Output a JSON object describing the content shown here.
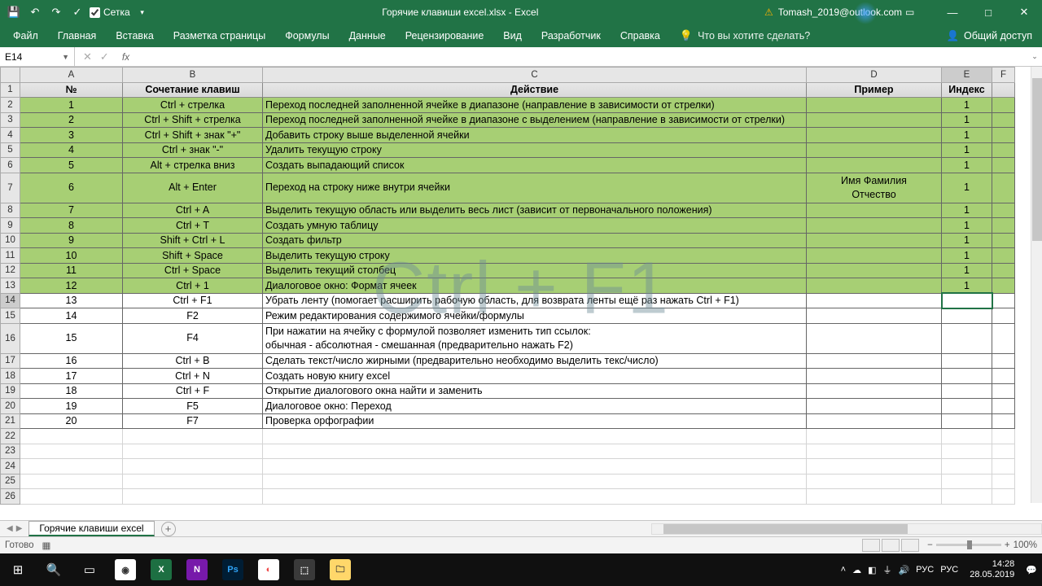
{
  "titlebar": {
    "grid_label": "Сетка",
    "doc_title": "Горячие клавиши excel.xlsx  -  Excel",
    "user": "Tomash_2019@outlook.com"
  },
  "ribbon": {
    "tabs": [
      "Файл",
      "Главная",
      "Вставка",
      "Разметка страницы",
      "Формулы",
      "Данные",
      "Рецензирование",
      "Вид",
      "Разработчик",
      "Справка"
    ],
    "tellme": "Что вы хотите сделать?",
    "share": "Общий доступ"
  },
  "formula": {
    "namebox": "E14",
    "fx": "fx",
    "value": ""
  },
  "columns": [
    "A",
    "B",
    "C",
    "D",
    "E",
    "F"
  ],
  "headers": {
    "num": "№",
    "combo": "Сочетание клавиш",
    "action": "Действие",
    "example": "Пример",
    "index": "Индекс"
  },
  "watermark": "Ctrl + F1",
  "chart_data": {
    "type": "table",
    "columns": [
      "№",
      "Сочетание клавиш",
      "Действие",
      "Пример",
      "Индекс"
    ],
    "rows": [
      {
        "n": 1,
        "combo": "Ctrl + стрелка",
        "action": "Переход последней заполненной ячейке в диапазоне (направление в зависимости от стрелки)",
        "ex": "",
        "idx": 1,
        "g": true
      },
      {
        "n": 2,
        "combo": "Ctrl + Shift + стрелка",
        "action": "Переход последней заполненной ячейке в диапазоне с выделением (направление в зависимости от стрелки)",
        "ex": "",
        "idx": 1,
        "g": true
      },
      {
        "n": 3,
        "combo": "Ctrl + Shift + знак \"+\"",
        "action": "Добавить строку выше выделенной ячейки",
        "ex": "",
        "idx": 1,
        "g": true
      },
      {
        "n": 4,
        "combo": "Ctrl + знак \"-\"",
        "action": "Удалить текущую строку",
        "ex": "",
        "idx": 1,
        "g": true
      },
      {
        "n": 5,
        "combo": "Alt + стрелка вниз",
        "action": "Создать выпадающий список",
        "ex": "",
        "idx": 1,
        "g": true
      },
      {
        "n": 6,
        "combo": "Alt + Enter",
        "action": "Переход на строку ниже внутри ячейки",
        "ex": "Имя Фамилия\nОтчество",
        "idx": 1,
        "g": true,
        "tall": true
      },
      {
        "n": 7,
        "combo": "Ctrl + A",
        "action": "Выделить текущую область или выделить весь лист (зависит от первоначального положения)",
        "ex": "",
        "idx": 1,
        "g": true
      },
      {
        "n": 8,
        "combo": "Ctrl + T",
        "action": "Создать умную таблицу",
        "ex": "",
        "idx": 1,
        "g": true
      },
      {
        "n": 9,
        "combo": "Shift + Ctrl + L",
        "action": "Создать фильтр",
        "ex": "",
        "idx": 1,
        "g": true
      },
      {
        "n": 10,
        "combo": "Shift + Space",
        "action": "Выделить текущую строку",
        "ex": "",
        "idx": 1,
        "g": true
      },
      {
        "n": 11,
        "combo": "Ctrl + Space",
        "action": "Выделить текущий столбец",
        "ex": "",
        "idx": 1,
        "g": true
      },
      {
        "n": 12,
        "combo": "Ctrl + 1",
        "action": "Диалоговое окно: Формат ячеек",
        "ex": "",
        "idx": 1,
        "g": true
      },
      {
        "n": 13,
        "combo": "Ctrl + F1",
        "action": "Убрать ленту (помогает расширить рабочую область, для возврата ленты ещё раз нажать Ctrl + F1)",
        "ex": "",
        "idx": "",
        "g": false,
        "sel": true
      },
      {
        "n": 14,
        "combo": "F2",
        "action": "Режим редактирования содержимого ячейки/формулы",
        "ex": "",
        "idx": "",
        "g": false
      },
      {
        "n": 15,
        "combo": "F4",
        "action": "При нажатии на ячейку с формулой позволяет изменить тип ссылок:\nобычная - абсолютная - смешанная (предварительно нажать F2)",
        "ex": "",
        "idx": "",
        "g": false,
        "tall": true
      },
      {
        "n": 16,
        "combo": "Ctrl + B",
        "action": "Сделать текст/число жирными (предварительно необходимо выделить текс/число)",
        "ex": "",
        "idx": "",
        "g": false
      },
      {
        "n": 17,
        "combo": "Ctrl + N",
        "action": "Создать новую книгу excel",
        "ex": "",
        "idx": "",
        "g": false
      },
      {
        "n": 18,
        "combo": "Ctrl + F",
        "action": "Открытие диалогового окна найти и заменить",
        "ex": "",
        "idx": "",
        "g": false
      },
      {
        "n": 19,
        "combo": "F5",
        "action": "Диалоговое окно: Переход",
        "ex": "",
        "idx": "",
        "g": false
      },
      {
        "n": 20,
        "combo": "F7",
        "action": "Проверка орфографии",
        "ex": "",
        "idx": "",
        "g": false
      }
    ]
  },
  "sheettab": "Горячие клавиши excel",
  "status": {
    "ready": "Готово",
    "zoom": "100%"
  },
  "taskbar": {
    "lang1": "РУС",
    "lang2": "РУС",
    "time": "14:28",
    "date": "28.05.2019"
  }
}
